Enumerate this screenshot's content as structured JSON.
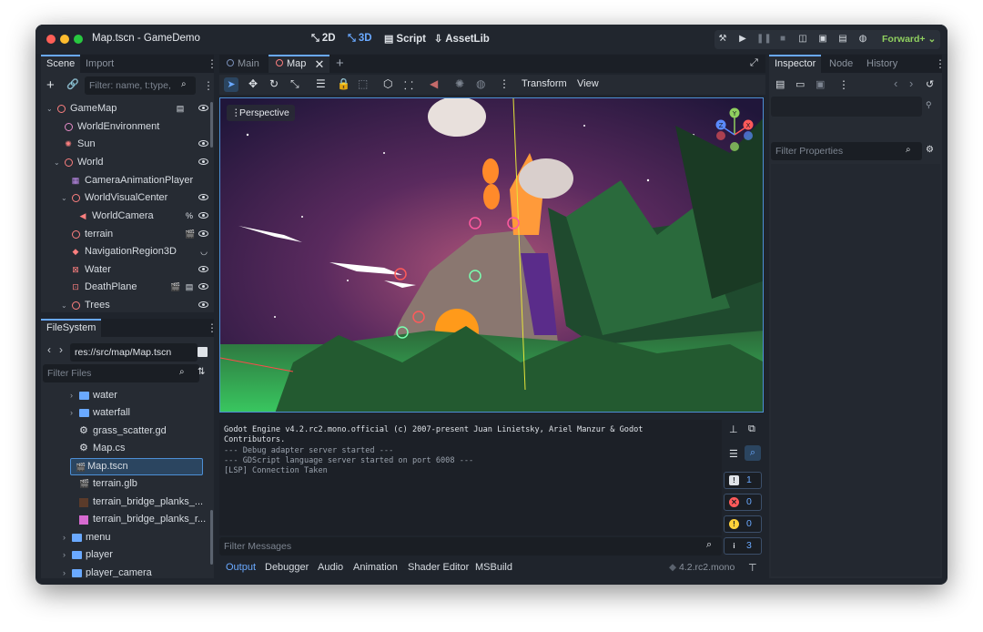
{
  "window": {
    "title": "Map.tscn - GameDemo"
  },
  "modes": {
    "m2d": "2D",
    "m3d": "3D",
    "script": "Script",
    "assetlib": "AssetLib"
  },
  "renderer": "Forward+",
  "scene_dock": {
    "tabs": [
      "Scene",
      "Import"
    ],
    "filter_placeholder": "Filter: name, t:type,",
    "nodes": [
      {
        "label": "GameMap"
      },
      {
        "label": "WorldEnvironment"
      },
      {
        "label": "Sun"
      },
      {
        "label": "World"
      },
      {
        "label": "CameraAnimationPlayer"
      },
      {
        "label": "WorldVisualCenter"
      },
      {
        "label": "WorldCamera"
      },
      {
        "label": "terrain"
      },
      {
        "label": "NavigationRegion3D"
      },
      {
        "label": "Water"
      },
      {
        "label": "DeathPlane"
      },
      {
        "label": "Trees"
      }
    ]
  },
  "filesystem": {
    "tab": "FileSystem",
    "path": "res://src/map/Map.tscn",
    "filter_placeholder": "Filter Files",
    "items": [
      {
        "label": "water"
      },
      {
        "label": "waterfall"
      },
      {
        "label": "grass_scatter.gd"
      },
      {
        "label": "Map.cs"
      },
      {
        "label": "Map.tscn"
      },
      {
        "label": "terrain.glb"
      },
      {
        "label": "terrain_bridge_planks_..."
      },
      {
        "label": "terrain_bridge_planks_r..."
      },
      {
        "label": "menu"
      },
      {
        "label": "player"
      },
      {
        "label": "player_camera"
      }
    ]
  },
  "editor_tabs": [
    "Main",
    "Map"
  ],
  "viewport_toolbar": {
    "transform": "Transform",
    "view": "View"
  },
  "viewport": {
    "perspective": "Perspective"
  },
  "gizmo": {
    "y": "Y",
    "x": "X",
    "z": "Z"
  },
  "console": {
    "lines": [
      "Godot Engine v4.2.rc2.mono.official (c) 2007-present Juan Linietsky, Ariel Manzur & Godot",
      "Contributors.",
      "--- Debug adapter server started ---",
      "--- GDScript language server started on port 6008 ---",
      "[LSP] Connection Taken"
    ],
    "filter_placeholder": "Filter Messages",
    "counts": {
      "errors_all": "1",
      "errors": "0",
      "warnings": "0",
      "info": "3"
    }
  },
  "bottom_panel": {
    "tabs": [
      "Output",
      "Debugger",
      "Audio",
      "Animation",
      "Shader Editor",
      "MSBuild"
    ],
    "version": "4.2.rc2.mono"
  },
  "inspector": {
    "tabs": [
      "Inspector",
      "Node",
      "History"
    ],
    "filter_placeholder": "Filter Properties"
  },
  "colors": {
    "accent": "#6aa9ff",
    "node3d": "#fc7f7f",
    "renderer": "#8fcf5f",
    "panel": "#262b33",
    "base": "#1f242c"
  }
}
